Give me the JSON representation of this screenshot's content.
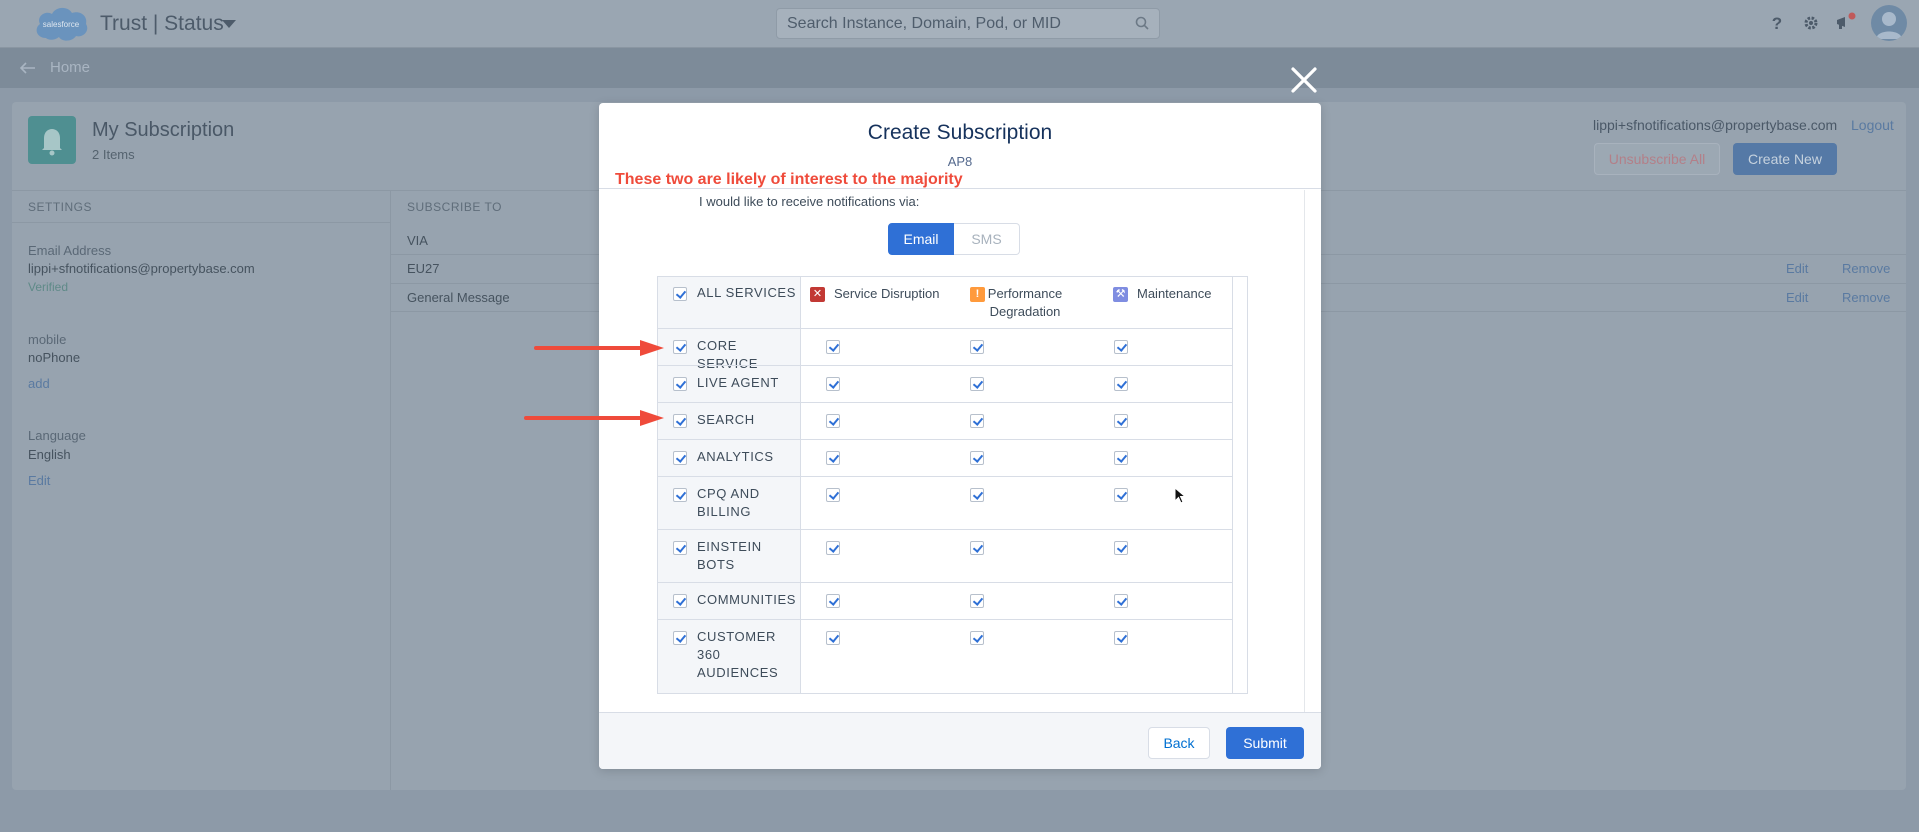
{
  "header": {
    "app_title": "Trust | Status",
    "search_placeholder": "Search Instance, Domain, Pod, or MID",
    "logo_text": "salesforce"
  },
  "subnav": {
    "home_label": "Home"
  },
  "page": {
    "title": "My Subscription",
    "subtitle": "2 Items",
    "user_email": "lippi+sfnotifications@propertybase.com",
    "logout_label": "Logout",
    "unsubscribe_all_label": "Unsubscribe All",
    "create_new_label": "Create New"
  },
  "settings": {
    "heading": "SETTINGS",
    "email_label": "Email Address",
    "email_value": "lippi+sfnotifications@propertybase.com",
    "email_status": "Verified",
    "mobile_label": "mobile",
    "mobile_value": "noPhone",
    "mobile_add": "add",
    "language_label": "Language",
    "language_value": "English",
    "language_edit": "Edit"
  },
  "subscribe_to": {
    "heading": "SUBSCRIBE TO",
    "via": "VIA",
    "rows": [
      {
        "name": "EU27",
        "edit": "Edit",
        "remove": "Remove"
      },
      {
        "name": "General Message",
        "edit": "Edit",
        "remove": "Remove"
      }
    ]
  },
  "modal": {
    "title": "Create Subscription",
    "subtitle": "AP8",
    "annotation": "These two are likely of interest to the majority",
    "notif_label": "I would like to receive notifications via:",
    "channels": {
      "email": "Email",
      "sms": "SMS"
    },
    "all_services": "ALL SERVICES",
    "columns": [
      {
        "label": "Service Disruption",
        "icon": "x-icon",
        "color": "#c23934"
      },
      {
        "label": "Performance Degradation",
        "icon": "exclamation-icon",
        "color": "#ff9a3c"
      },
      {
        "label": "Maintenance",
        "icon": "wrench-icon",
        "color": "#7f8de1"
      }
    ],
    "services": [
      "CORE SERVICE",
      "LIVE AGENT",
      "SEARCH",
      "ANALYTICS",
      "CPQ AND BILLING",
      "EINSTEIN BOTS",
      "COMMUNITIES",
      "CUSTOMER 360 AUDIENCES"
    ],
    "back_label": "Back",
    "submit_label": "Submit"
  },
  "colors": {
    "accent": "#2f70d6",
    "annotation": "#ef4b3b",
    "overlay": "#8d9aa8"
  }
}
